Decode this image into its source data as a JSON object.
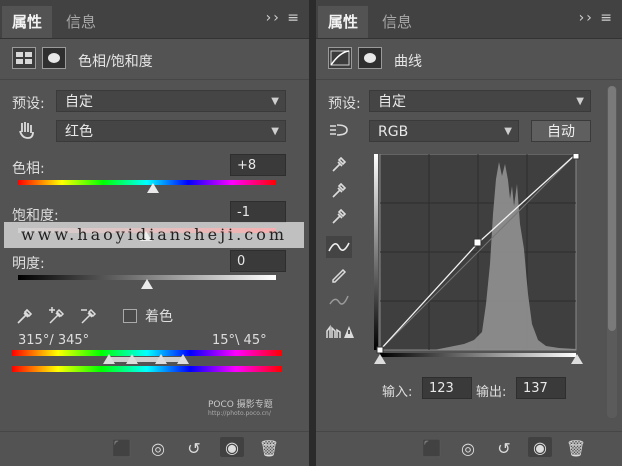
{
  "left_panel": {
    "tab_active": "属性",
    "tab_inactive": "信息",
    "menu_glyphs": "›› ≡",
    "adjustment_title": "色相/饱和度",
    "preset_label": "预设:",
    "preset_value": "自定",
    "channel_value": "红色",
    "hue_label": "色相:",
    "hue_value": "+8",
    "hue_level": 8,
    "saturation_label": "饱和度:",
    "saturation_value": "-1",
    "saturation_level": -1,
    "lightness_label": "明度:",
    "lightness_value": "0",
    "lightness_level": 0,
    "colorize_label": "着色",
    "range_left": "315°/ 345°",
    "range_right": "15°\\ 45°"
  },
  "right_panel": {
    "tab_active": "属性",
    "tab_inactive": "信息",
    "menu_glyphs": "›› ≡",
    "adjustment_title": "曲线",
    "preset_label": "预设:",
    "preset_value": "自定",
    "channel_value": "RGB",
    "auto_button": "自动",
    "input_label": "输入:",
    "input_value": "123",
    "output_label": "输出:",
    "output_value": "137"
  },
  "watermark_text": "www.haoyidiansheji.com",
  "poco_brand": "POCO 摄影专题",
  "poco_url": "http://photo.poco.cn/",
  "footer_icons": [
    "clip-to-layer-icon",
    "view-previous-icon",
    "reset-icon",
    "visibility-eye-icon",
    "trash-icon"
  ]
}
